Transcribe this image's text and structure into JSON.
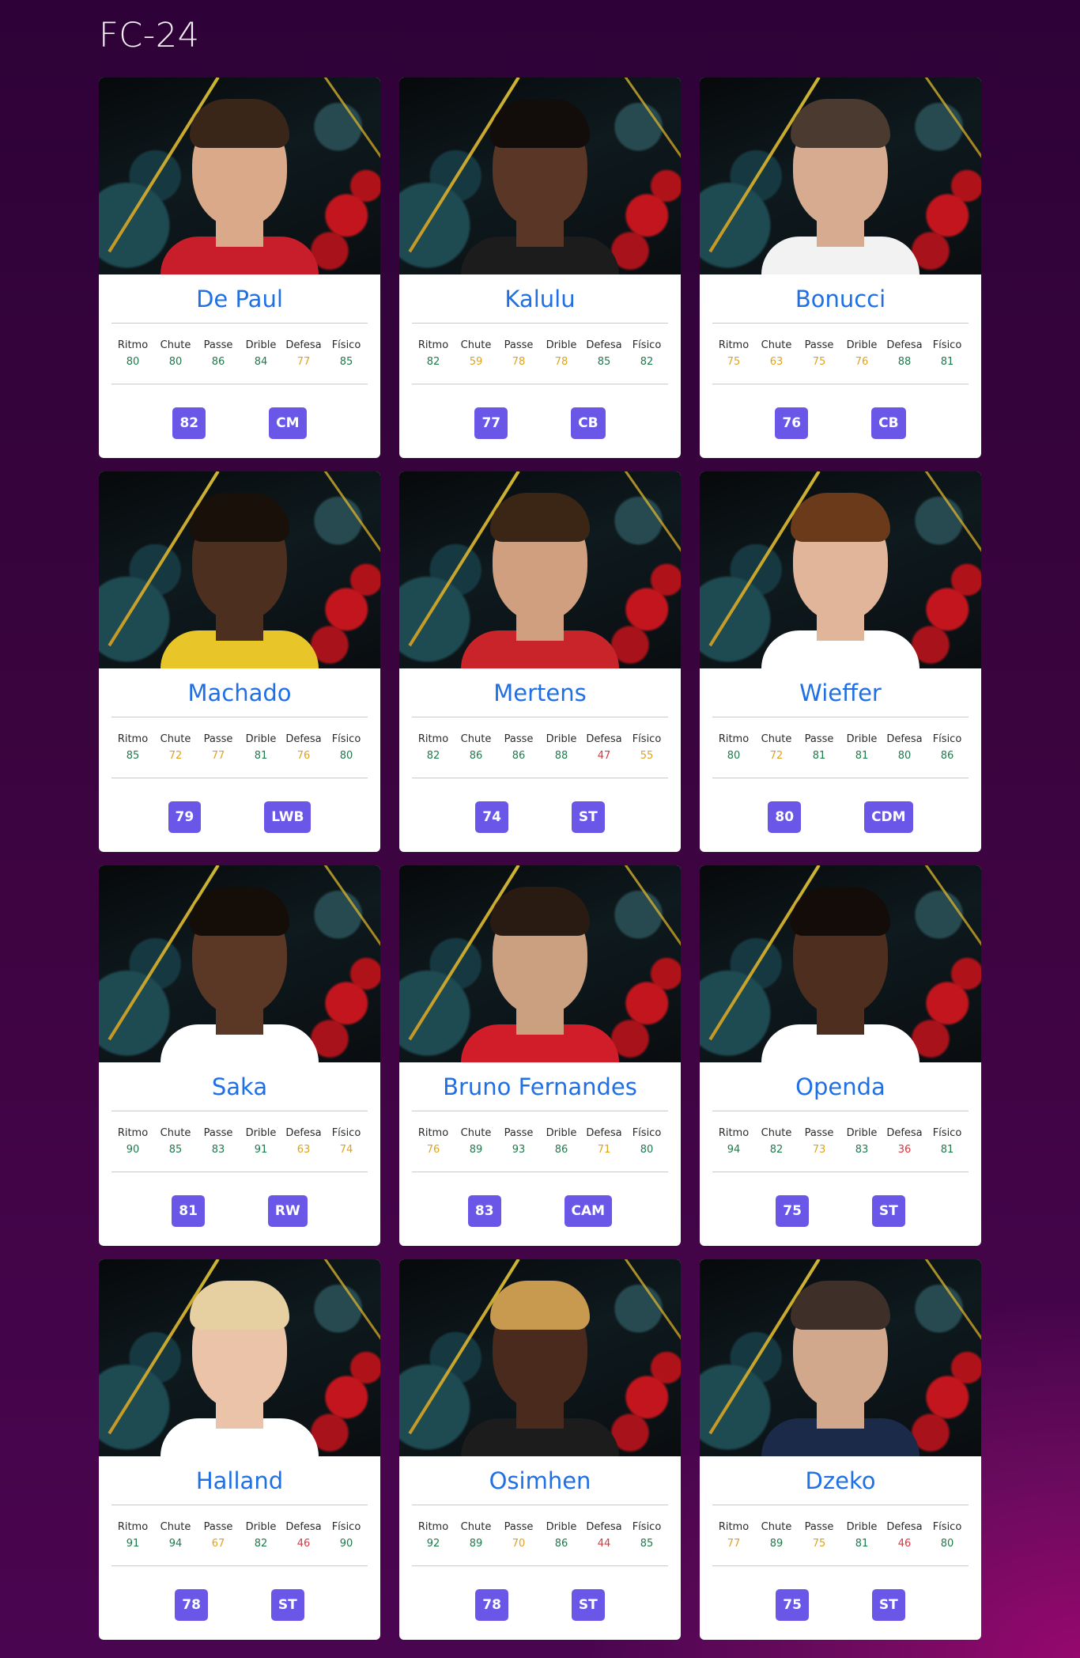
{
  "page": {
    "title": "FC-24",
    "colors": {
      "name": "#1f6fe5",
      "badge": "#6a57e8",
      "stat_good": "#1d7a4a",
      "stat_mid": "#e0a21a",
      "stat_bad": "#e0323c"
    }
  },
  "stat_labels": [
    "Ritmo",
    "Chute",
    "Passe",
    "Drible",
    "Defesa",
    "Físico"
  ],
  "players": [
    {
      "name": "De Paul",
      "overall": "82",
      "position": "CM",
      "stats": [
        "80",
        "80",
        "86",
        "84",
        "77",
        "85"
      ],
      "skin": "#d9a989",
      "hair": "#3a2618",
      "shirt": "#c81d2a"
    },
    {
      "name": "Kalulu",
      "overall": "77",
      "position": "CB",
      "stats": [
        "82",
        "59",
        "78",
        "78",
        "85",
        "82"
      ],
      "skin": "#5a3626",
      "hair": "#120c0a",
      "shirt": "#1c1c1c"
    },
    {
      "name": "Bonucci",
      "overall": "76",
      "position": "CB",
      "stats": [
        "75",
        "63",
        "75",
        "76",
        "88",
        "81"
      ],
      "skin": "#d6ab90",
      "hair": "#4a3a30",
      "shirt": "#f2f2f2"
    },
    {
      "name": "Machado",
      "overall": "79",
      "position": "LWB",
      "stats": [
        "85",
        "72",
        "77",
        "81",
        "76",
        "80"
      ],
      "skin": "#4d2f20",
      "hair": "#1a100a",
      "shirt": "#e8c62a"
    },
    {
      "name": "Mertens",
      "overall": "74",
      "position": "ST",
      "stats": [
        "82",
        "86",
        "86",
        "88",
        "47",
        "55"
      ],
      "skin": "#cf9f80",
      "hair": "#3b2616",
      "shirt": "#c8242a"
    },
    {
      "name": "Wieffer",
      "overall": "80",
      "position": "CDM",
      "stats": [
        "80",
        "72",
        "81",
        "81",
        "80",
        "86"
      ],
      "skin": "#e1b59a",
      "hair": "#6a3a1a",
      "shirt": "#ffffff"
    },
    {
      "name": "Saka",
      "overall": "81",
      "position": "RW",
      "stats": [
        "90",
        "85",
        "83",
        "91",
        "63",
        "74"
      ],
      "skin": "#5b3725",
      "hair": "#150d08",
      "shirt": "#ffffff"
    },
    {
      "name": "Bruno Fernandes",
      "overall": "83",
      "position": "CAM",
      "stats": [
        "76",
        "89",
        "93",
        "86",
        "71",
        "80"
      ],
      "skin": "#caa080",
      "hair": "#2a1b12",
      "shirt": "#d11c2a"
    },
    {
      "name": "Openda",
      "overall": "75",
      "position": "ST",
      "stats": [
        "94",
        "82",
        "73",
        "83",
        "36",
        "81"
      ],
      "skin": "#4e2e1e",
      "hair": "#130c08",
      "shirt": "#ffffff"
    },
    {
      "name": "Halland",
      "overall": "78",
      "position": "ST",
      "stats": [
        "91",
        "94",
        "67",
        "82",
        "46",
        "90"
      ],
      "skin": "#eac3a8",
      "hair": "#e6cfa0",
      "shirt": "#ffffff"
    },
    {
      "name": "Osimhen",
      "overall": "78",
      "position": "ST",
      "stats": [
        "92",
        "89",
        "70",
        "86",
        "44",
        "85"
      ],
      "skin": "#4a2a1c",
      "hair": "#c89a50",
      "shirt": "#1c1c1c"
    },
    {
      "name": "Dzeko",
      "overall": "75",
      "position": "ST",
      "stats": [
        "77",
        "89",
        "75",
        "81",
        "46",
        "80"
      ],
      "skin": "#d2a88c",
      "hair": "#3e3028",
      "shirt": "#1c2a4a"
    }
  ]
}
